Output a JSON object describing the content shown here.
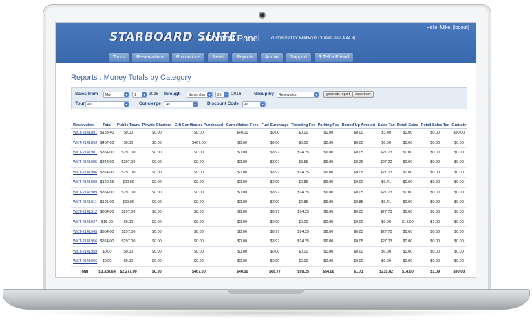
{
  "header": {
    "logo": "STARBOARD SUITE",
    "tm": "TM",
    "title": "Control Panel",
    "customized": "customized for Wildwood Cruises (rev. 4.44.8)",
    "greeting": "Hello, Mike.",
    "logout": "[logout]"
  },
  "nav": [
    "Tours",
    "Reservations",
    "Promotions",
    "Retail",
    "Reports",
    "Admin",
    "Support",
    "$ Tell a Friend"
  ],
  "page_title": "Reports : Money Totals by Category",
  "filters": {
    "sales_from_label": "Sales from",
    "from_month": "May",
    "from_day": "1",
    "from_year": "2016",
    "through_label": "through",
    "to_month": "September",
    "to_day": "25",
    "to_year": "2016",
    "group_by_label": "Group by",
    "group_by": "Reservation",
    "generate_button": "generate report",
    "export_button": "export csv",
    "tour_label": "Tour",
    "tour": "All",
    "concierge_label": "Concierge",
    "concierge": "All",
    "discount_label": "Discount Code",
    "discount": "All",
    "arrow": "▾"
  },
  "table": {
    "headers": [
      "Reservation",
      "Total",
      "Public Tours",
      "Private Charters",
      "Gift Certificates Purchased",
      "Cancellation Fees",
      "Fuel Surcharge",
      "Ticketing Fee",
      "Parking Fee",
      "Round Up Amount",
      "Sales Tax",
      "Retail Sales",
      "Retail Sales Tax",
      "Gratuity"
    ],
    "rows": [
      [
        "WKT-2141891",
        "$133.40",
        "$0.00",
        "$0.00",
        "$0.00",
        "$40.00",
        "$0.00",
        "$0.00",
        "$0.00",
        "$0.00",
        "$3.40",
        "$0.00",
        "$0.00",
        "$90.00"
      ],
      [
        "WKT-2141893",
        "$467.00",
        "$0.00",
        "$0.00",
        "$467.00",
        "$0.00",
        "$0.00",
        "$0.00",
        "$0.00",
        "$0.00",
        "$0.00",
        "$0.00",
        "$0.00",
        "$0.00"
      ],
      [
        "WKT-2141901",
        "$354.00",
        "$297.00",
        "$0.00",
        "$0.00",
        "$0.00",
        "$8.97",
        "$14.25",
        "$6.00",
        "$0.05",
        "$27.73",
        "$0.00",
        "$0.00",
        "$0.00"
      ],
      [
        "WKT-2141905",
        "$348.00",
        "$297.00",
        "$0.00",
        "$0.00",
        "$0.00",
        "$8.97",
        "$8.55",
        "$6.00",
        "$0.26",
        "$27.22",
        "$0.00",
        "$0.00",
        "$0.00"
      ],
      [
        "WKT-2141906",
        "$354.00",
        "$297.00",
        "$0.00",
        "$0.00",
        "$0.00",
        "$8.97",
        "$14.25",
        "$6.00",
        "$0.05",
        "$27.73",
        "$0.00",
        "$0.00",
        "$0.00"
      ],
      [
        "WKT-2141908",
        "$120.15",
        "$99.00",
        "$0.00",
        "$0.00",
        "$0.00",
        "$2.99",
        "$2.85",
        "$6.00",
        "$0.00",
        "$9.41",
        "$0.00",
        "$0.00",
        "$0.00"
      ],
      [
        "WKT-2141909",
        "$354.00",
        "$297.00",
        "$0.00",
        "$0.00",
        "$0.00",
        "$8.97",
        "$14.25",
        "$6.00",
        "$0.05",
        "$27.73",
        "$0.00",
        "$0.00",
        "$0.00"
      ],
      [
        "WKT-2141911",
        "$121.00",
        "$99.00",
        "$0.00",
        "$0.00",
        "$0.00",
        "$2.99",
        "$2.85",
        "$6.00",
        "$0.85",
        "$9.41",
        "$0.00",
        "$0.00",
        "$0.00"
      ],
      [
        "WKT-2141912",
        "$354.00",
        "$297.00",
        "$0.00",
        "$0.00",
        "$0.00",
        "$8.97",
        "$14.25",
        "$6.00",
        "$0.05",
        "$27.73",
        "$0.00",
        "$0.00",
        "$0.00"
      ],
      [
        "WKT-2141937",
        "$15.09",
        "$0.00",
        "$0.00",
        "$0.00",
        "$0.00",
        "$0.00",
        "$0.00",
        "$0.00",
        "$0.00",
        "$0.00",
        "$14.00",
        "$1.09",
        "$0.00"
      ],
      [
        "WKT-2141945",
        "$354.00",
        "$297.00",
        "$0.00",
        "$0.00",
        "$0.00",
        "$8.97",
        "$14.25",
        "$6.00",
        "$0.05",
        "$27.73",
        "$0.00",
        "$0.00",
        "$0.00"
      ],
      [
        "WKT-2141956",
        "$354.00",
        "$297.00",
        "$0.00",
        "$0.00",
        "$0.00",
        "$8.97",
        "$14.25",
        "$6.00",
        "$0.05",
        "$27.73",
        "$0.00",
        "$0.00",
        "$0.00"
      ],
      [
        "WKT-2141959",
        "$0.00",
        "$0.00",
        "$0.00",
        "$0.00",
        "$0.00",
        "$0.00",
        "$0.00",
        "$0.00",
        "$0.00",
        "$0.00",
        "$0.00",
        "$0.00",
        "$0.00"
      ],
      [
        "WKT-2141966",
        "$0.00",
        "$0.00",
        "$0.00",
        "$0.00",
        "$0.00",
        "$0.00",
        "$0.00",
        "$0.00",
        "$0.00",
        "$0.00",
        "$0.00",
        "$0.00",
        "$0.00"
      ]
    ],
    "totals": [
      "Total:",
      "$3,328.64",
      "$2,277.00",
      "$0.00",
      "$467.00",
      "$40.00",
      "$68.77",
      "$99.25",
      "$54.00",
      "$1.71",
      "$215.82",
      "$14.00",
      "$1.09",
      "$90.00"
    ]
  }
}
